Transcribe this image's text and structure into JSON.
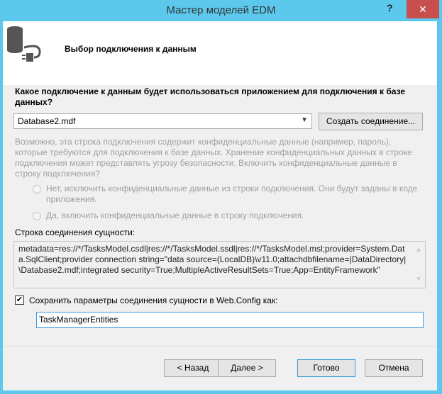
{
  "window": {
    "title": "Мастер моделей EDM",
    "help": "?",
    "close": "✕"
  },
  "header": {
    "title": "Выбор подключения к данным",
    "icon": "database-plug-icon"
  },
  "question": "Какое подключение к данным будет использоваться приложением для подключения к базе данных?",
  "connection_combo": {
    "value": "Database2.mdf"
  },
  "create_connection_label": "Создать соединение...",
  "warning": "Возможно, эта строка подключения содержит конфиденциальные данные (например, пароль), которые требуются для подключения к базе данных. Хранение конфиденциальных данных в строке подключения может представлять угрозу безопасности. Включить конфиденциальные данные в строку подключения?",
  "radio_no": "Нет, исключить конфиденциальные данные из строки подключения. Они будут заданы в коде приложения.",
  "radio_yes": "Да, включить конфиденциальные данные в строку подключения.",
  "entity_conn_label": "Строка соединения сущности:",
  "entity_conn_string": "metadata=res://*/TasksModel.csdl|res://*/TasksModel.ssdl|res://*/TasksModel.msl;provider=System.Data.SqlClient;provider connection string=\"data source=(LocalDB)\\v11.0;attachdbfilename=|DataDirectory|\\Database2.mdf;integrated security=True;MultipleActiveResultSets=True;App=EntityFramework\"",
  "save_checkbox": {
    "label": "Сохранить параметры соединения сущности в Web.Config как:",
    "checked": true
  },
  "entity_name": "TaskManagerEntities",
  "buttons": {
    "back": "< Назад",
    "next": "Далее >",
    "finish": "Готово",
    "cancel": "Отмена"
  }
}
